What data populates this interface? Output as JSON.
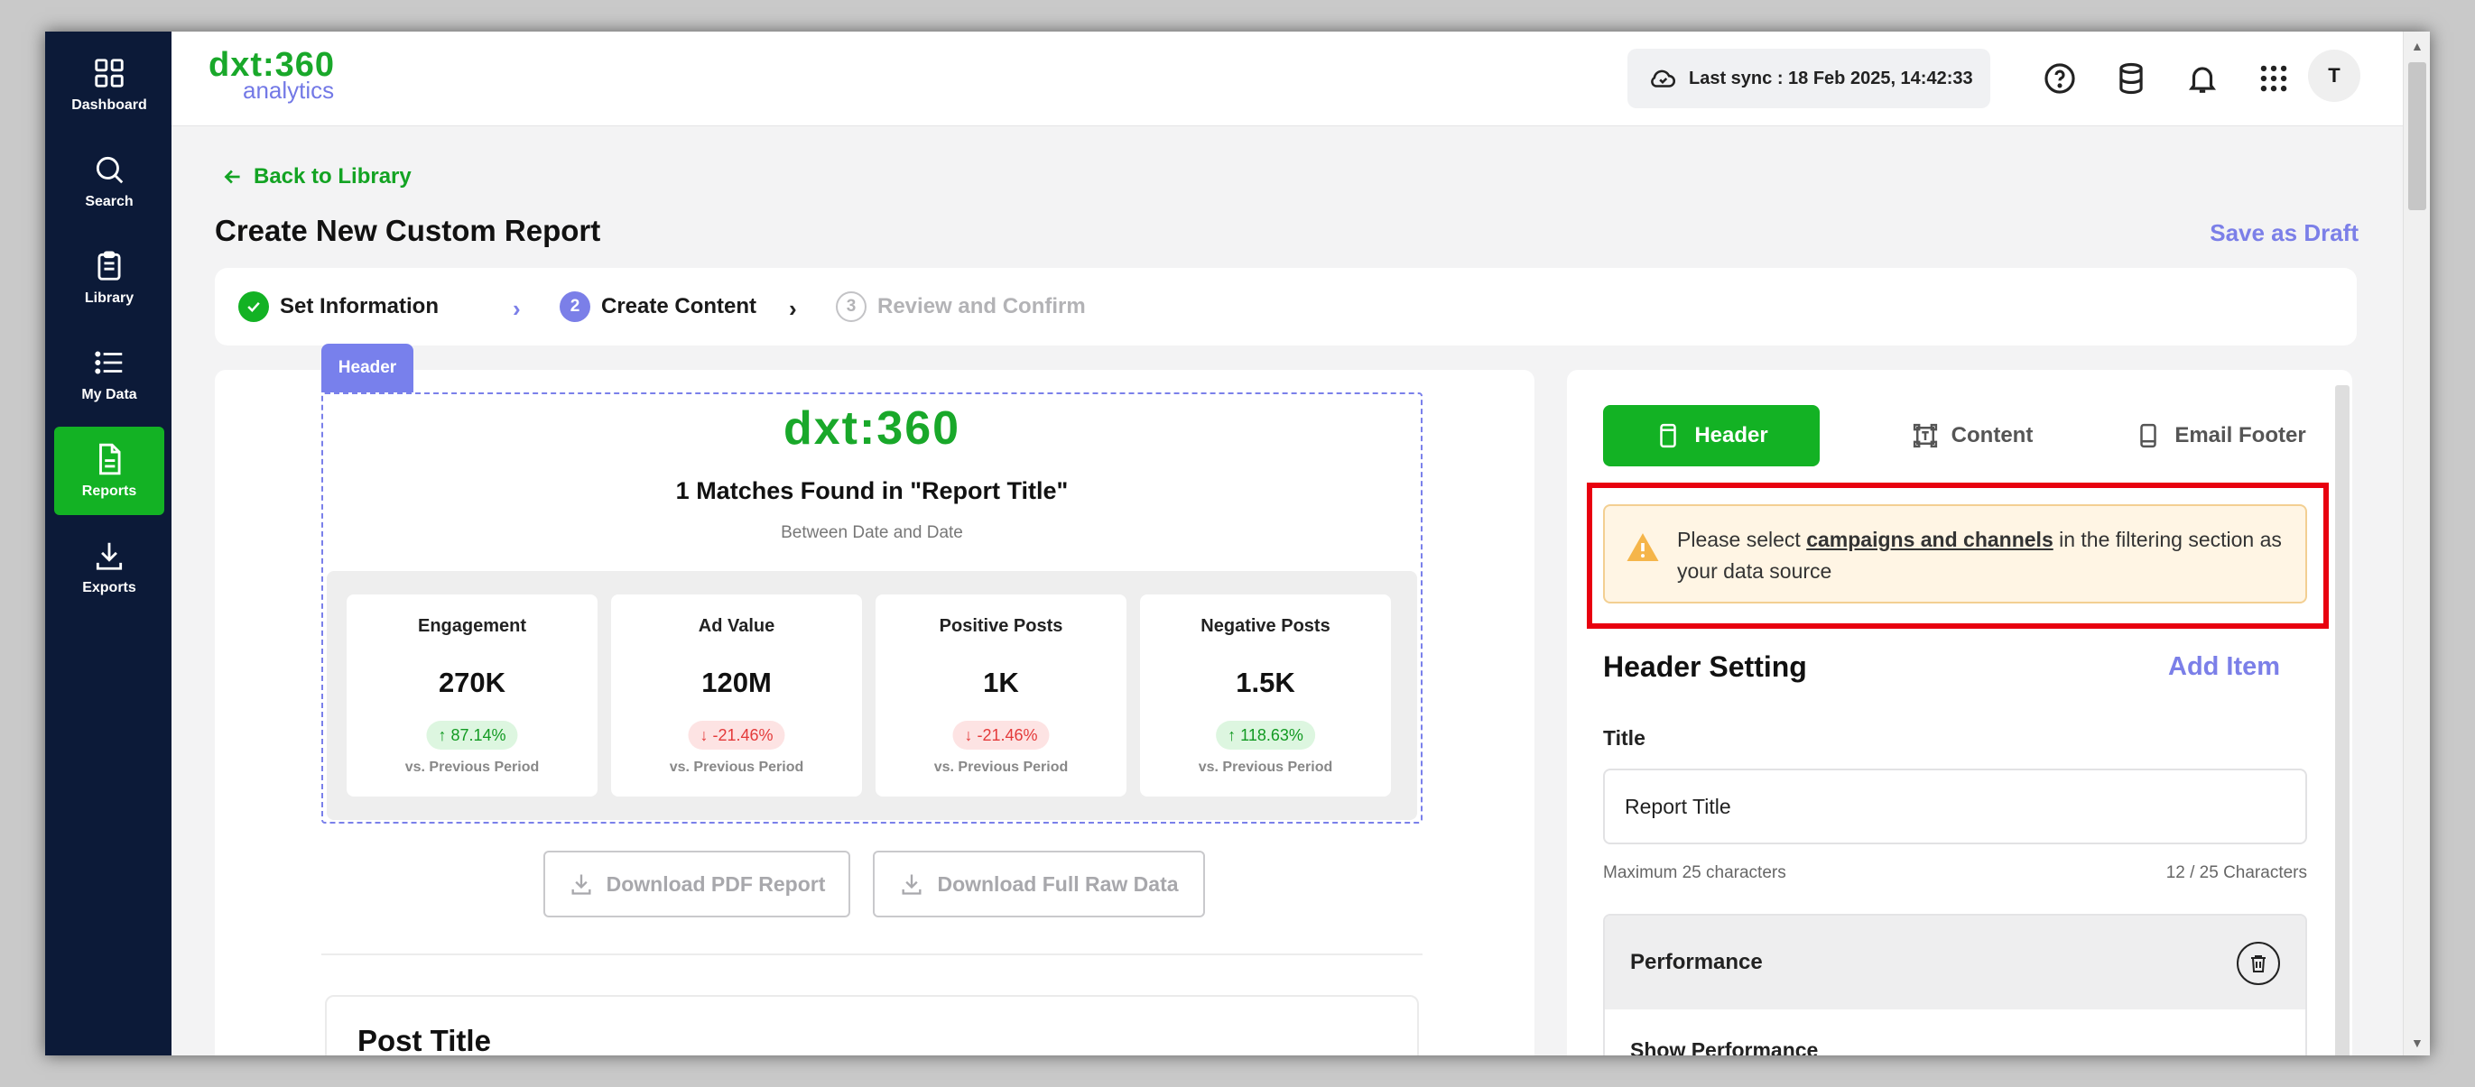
{
  "sidebar": {
    "items": [
      {
        "label": "Dashboard",
        "icon": "grid-icon"
      },
      {
        "label": "Search",
        "icon": "search-icon"
      },
      {
        "label": "Library",
        "icon": "clipboard-icon"
      },
      {
        "label": "My Data",
        "icon": "list-icon"
      },
      {
        "label": "Reports",
        "icon": "document-icon",
        "active": true
      },
      {
        "label": "Exports",
        "icon": "download-icon"
      }
    ]
  },
  "topbar": {
    "logo_main": "dxt:360",
    "logo_sub": "analytics",
    "sync_text": "Last sync : 18 Feb 2025, 14:42:33",
    "avatar_initial": "T"
  },
  "page": {
    "back_label": "Back to Library",
    "title": "Create New Custom Report",
    "save_draft_label": "Save as Draft"
  },
  "steps": [
    {
      "label": "Set Information",
      "state": "done"
    },
    {
      "label": "Create Content",
      "number": "2",
      "state": "current"
    },
    {
      "label": "Review and Confirm",
      "number": "3",
      "state": "pending"
    }
  ],
  "preview": {
    "section_tag": "Header",
    "logo": "dxt:360",
    "title": "1 Matches Found in \"Report Title\"",
    "subtitle": "Between Date and Date",
    "kpis": [
      {
        "label": "Engagement",
        "value": "270K",
        "change": "87.14%",
        "direction": "up",
        "period": "vs. Previous Period"
      },
      {
        "label": "Ad Value",
        "value": "120M",
        "change": "-21.46%",
        "direction": "down",
        "period": "vs. Previous Period"
      },
      {
        "label": "Positive Posts",
        "value": "1K",
        "change": "-21.46%",
        "direction": "down",
        "period": "vs. Previous Period"
      },
      {
        "label": "Negative Posts",
        "value": "1.5K",
        "change": "118.63%",
        "direction": "up",
        "period": "vs. Previous Period"
      }
    ],
    "download_pdf_label": "Download PDF Report",
    "download_raw_label": "Download Full Raw Data",
    "post_title": "Post Title"
  },
  "settings": {
    "tabs": [
      {
        "label": "Header",
        "active": true
      },
      {
        "label": "Content",
        "active": false
      },
      {
        "label": "Email Footer",
        "active": false
      }
    ],
    "alert_prefix": "Please select ",
    "alert_link": "campaigns and channels",
    "alert_suffix": " in the filtering section as your data source",
    "header_setting_title": "Header Setting",
    "add_item_label": "Add Item",
    "title_label": "Title",
    "title_value": "Report Title",
    "title_hint": "Maximum 25 characters",
    "title_count": "12 / 25 Characters",
    "performance_label": "Performance",
    "show_performance_label": "Show Performance"
  },
  "colors": {
    "brand_green": "#13b224",
    "accent_purple": "#7b7fe8",
    "sidebar_bg": "#0c1a38",
    "highlight_red": "#e8000f"
  }
}
